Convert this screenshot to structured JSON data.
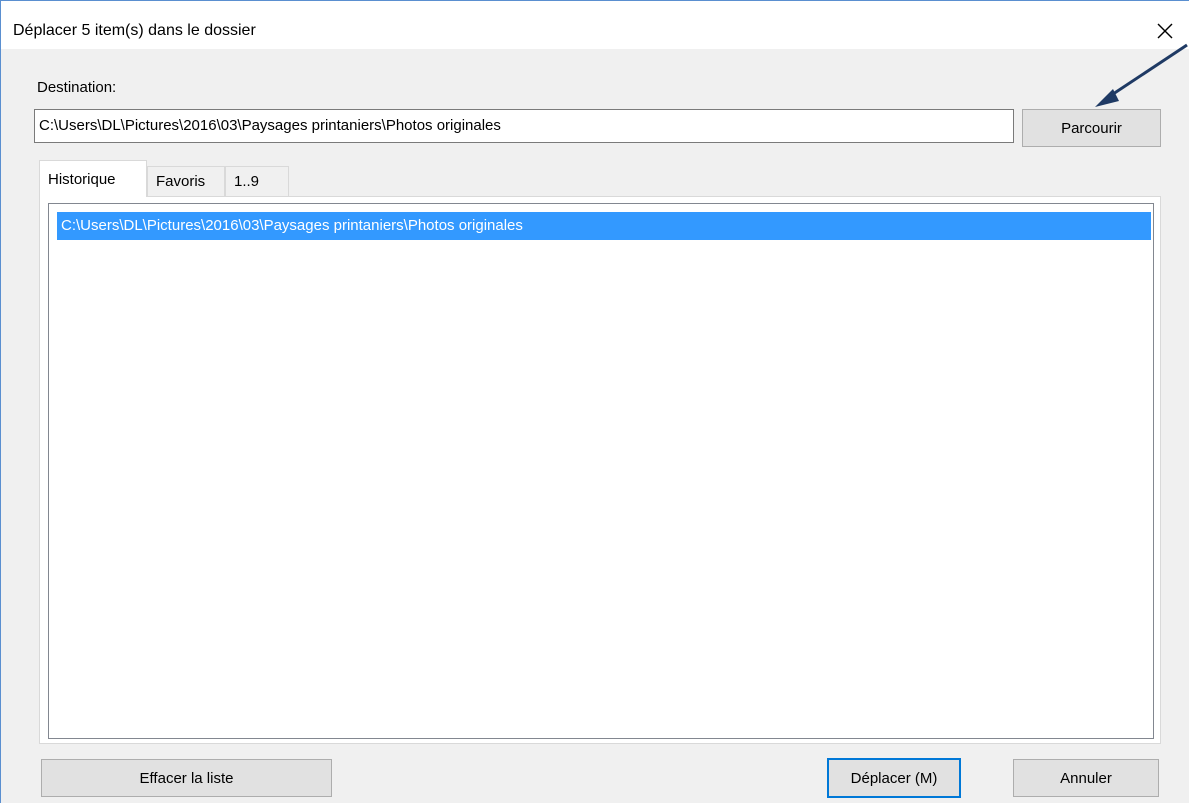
{
  "dialog": {
    "title": "Déplacer 5 item(s) dans le dossier",
    "close_icon": "close-icon"
  },
  "destination": {
    "label": "Destination:",
    "value": "C:\\Users\\DL\\Pictures\\2016\\03\\Paysages printaniers\\Photos originales",
    "browse_label": "Parcourir"
  },
  "tabs": [
    {
      "label": "Historique",
      "active": true
    },
    {
      "label": "Favoris",
      "active": false
    },
    {
      "label": "1..9",
      "active": false
    }
  ],
  "history_list": [
    {
      "path": "C:\\Users\\DL\\Pictures\\2016\\03\\Paysages printaniers\\Photos originales",
      "selected": true
    }
  ],
  "buttons": {
    "clear_label": "Effacer la liste",
    "move_label": "Déplacer (M)",
    "cancel_label": "Annuler"
  },
  "colors": {
    "selection": "#3399ff",
    "default_button_border": "#0078d7",
    "annotation_arrow": "#1f3a64"
  }
}
